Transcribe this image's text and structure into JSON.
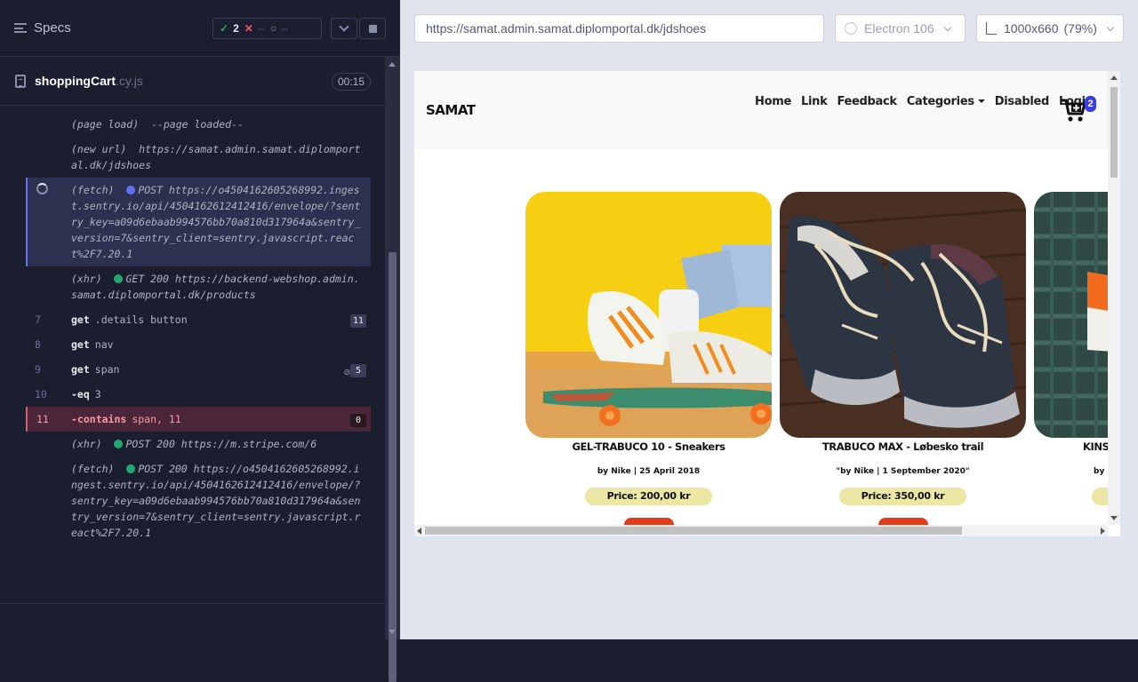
{
  "reporter": {
    "title": "Specs",
    "stats": {
      "passed": "2",
      "failed": "--",
      "pending": "--"
    },
    "file": {
      "name": "shoppingCart",
      "ext": ".cy.js",
      "duration": "00:15"
    }
  },
  "log": [
    {
      "num": "",
      "cmd": "(page load)",
      "arg": "--page loaded--",
      "type": "event"
    },
    {
      "num": "",
      "cmd": "(new url)",
      "arg": "https://samat.admin.samat.diplomportal.dk/jdshoes",
      "type": "event"
    },
    {
      "num": "",
      "cmd": "(fetch)",
      "arg": "POST https://o4504162605268992.ingest.sentry.io/api/4504162612412416/envelope/?sentry_key=a09d6ebaab994576bb70a810d317964a&sentry_version=7&sentry_client=sentry.javascript.react%2F7.20.1",
      "type": "active"
    },
    {
      "num": "",
      "cmd": "(xhr)",
      "arg": "GET 200 https://backend-webshop.admin.samat.diplomportal.dk/products",
      "type": "event"
    },
    {
      "num": "7",
      "cmd": "get",
      "arg": ".details button",
      "badge": "11",
      "type": "cmd"
    },
    {
      "num": "8",
      "cmd": "get",
      "arg": "nav",
      "type": "cmd"
    },
    {
      "num": "9",
      "cmd": "get",
      "arg": "span",
      "badge": "5",
      "type": "cmd"
    },
    {
      "num": "10",
      "cmd": "-eq",
      "arg": "3",
      "type": "cmd"
    },
    {
      "num": "11",
      "cmd": "-contains",
      "arg": "span, 11",
      "badge": "0",
      "type": "failed"
    },
    {
      "num": "",
      "cmd": "(xhr)",
      "arg": "POST 200 https://m.stripe.com/6",
      "type": "event"
    },
    {
      "num": "",
      "cmd": "(fetch)",
      "arg": "POST 200 https://o4504162605268992.ingest.sentry.io/api/4504162612412416/envelope/?sentry_key=a09d6ebaab994576bb70a810d317964a&sentry_version=7&sentry_client=sentry.javascript.react%2F7.20.1",
      "type": "event"
    }
  ],
  "browser": {
    "url": "https://samat.admin.samat.diplomportal.dk/jdshoes",
    "engine": "Electron 106",
    "viewport": "1000x660",
    "zoom": "(79%)"
  },
  "site": {
    "brand": "SAMAT",
    "nav": [
      "Home",
      "Link",
      "Feedback",
      "Categories",
      "Disabled",
      "Login"
    ],
    "cart_count": "2",
    "products": [
      {
        "title": "GEL-TRABUCO 10 - Sneakers",
        "by": "by Nike | 25 April 2018",
        "price": "Price: 200,00 kr"
      },
      {
        "title": "TRABUCO MAX - Løbesko trail",
        "by": "\"by Nike | 1 September 2020\"",
        "price": "Price: 350,00 kr"
      },
      {
        "title": "KINSE",
        "by": "by",
        "price": ""
      }
    ]
  },
  "colors": {
    "accent": "#6470f3",
    "passed": "#1fa971",
    "failed": "#e45770"
  }
}
